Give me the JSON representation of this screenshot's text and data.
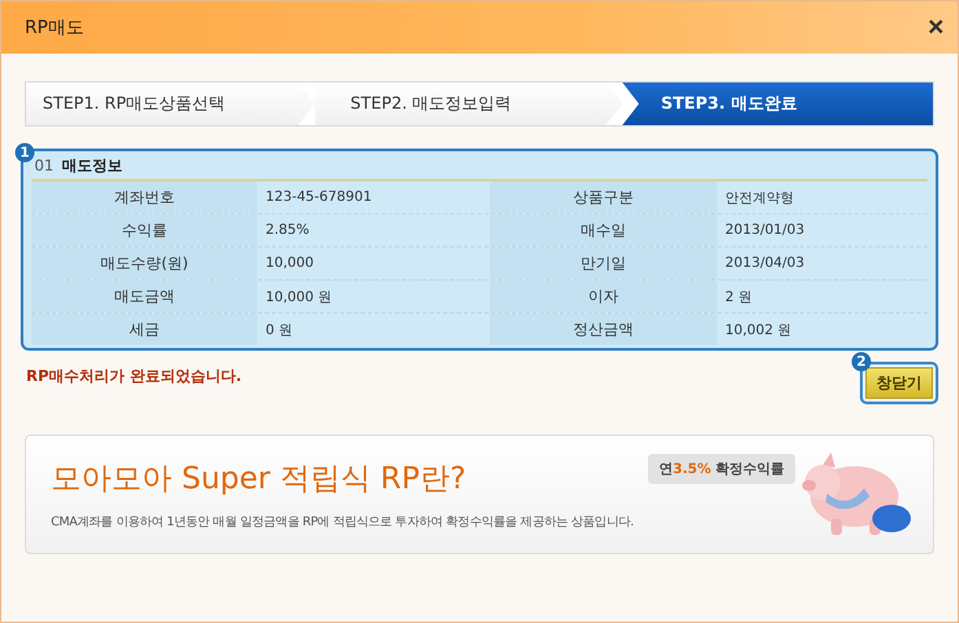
{
  "window": {
    "title": "RP매도",
    "close": "×"
  },
  "steps": [
    {
      "label": "STEP1. RP매도상품선택",
      "selected": false
    },
    {
      "label": "STEP2. 매도정보입력",
      "selected": false
    },
    {
      "label": "STEP3. 매도완료",
      "selected": true
    }
  ],
  "info": {
    "badge": "1",
    "number": "01",
    "title": "매도정보",
    "rows": [
      {
        "label_1": "계좌번호",
        "value_1": "123-45-678901",
        "label_2": "상품구분",
        "value_2": "안전계약형"
      },
      {
        "label_1": "수익률",
        "value_1": "2.85%",
        "label_2": "매수일",
        "value_2": "2013/01/03"
      },
      {
        "label_1": "매도수량(원)",
        "value_1": "10,000",
        "label_2": "만기일",
        "value_2": "2013/04/03"
      },
      {
        "label_1": "매도금액",
        "value_1": "10,000 원",
        "label_2": "이자",
        "value_2": "2 원"
      },
      {
        "label_1": "세금",
        "value_1": "0 원",
        "label_2": "정산금액",
        "value_2": "10,002 원"
      }
    ]
  },
  "message": "RP매수처리가 완료되었습니다.",
  "close_button": {
    "badge": "2",
    "label": "창닫기"
  },
  "banner": {
    "headline": "모아모아 Super 적립식 RP란?",
    "description": "CMA계좌를 이용하여 1년동안 매월 일정금액을 RP에 적립식으로 투자하여 확정수익률을 제공하는 상품입니다.",
    "callout": {
      "prefix": "연",
      "highlight": "3.5%",
      "suffix": " 확정수익률"
    }
  }
}
